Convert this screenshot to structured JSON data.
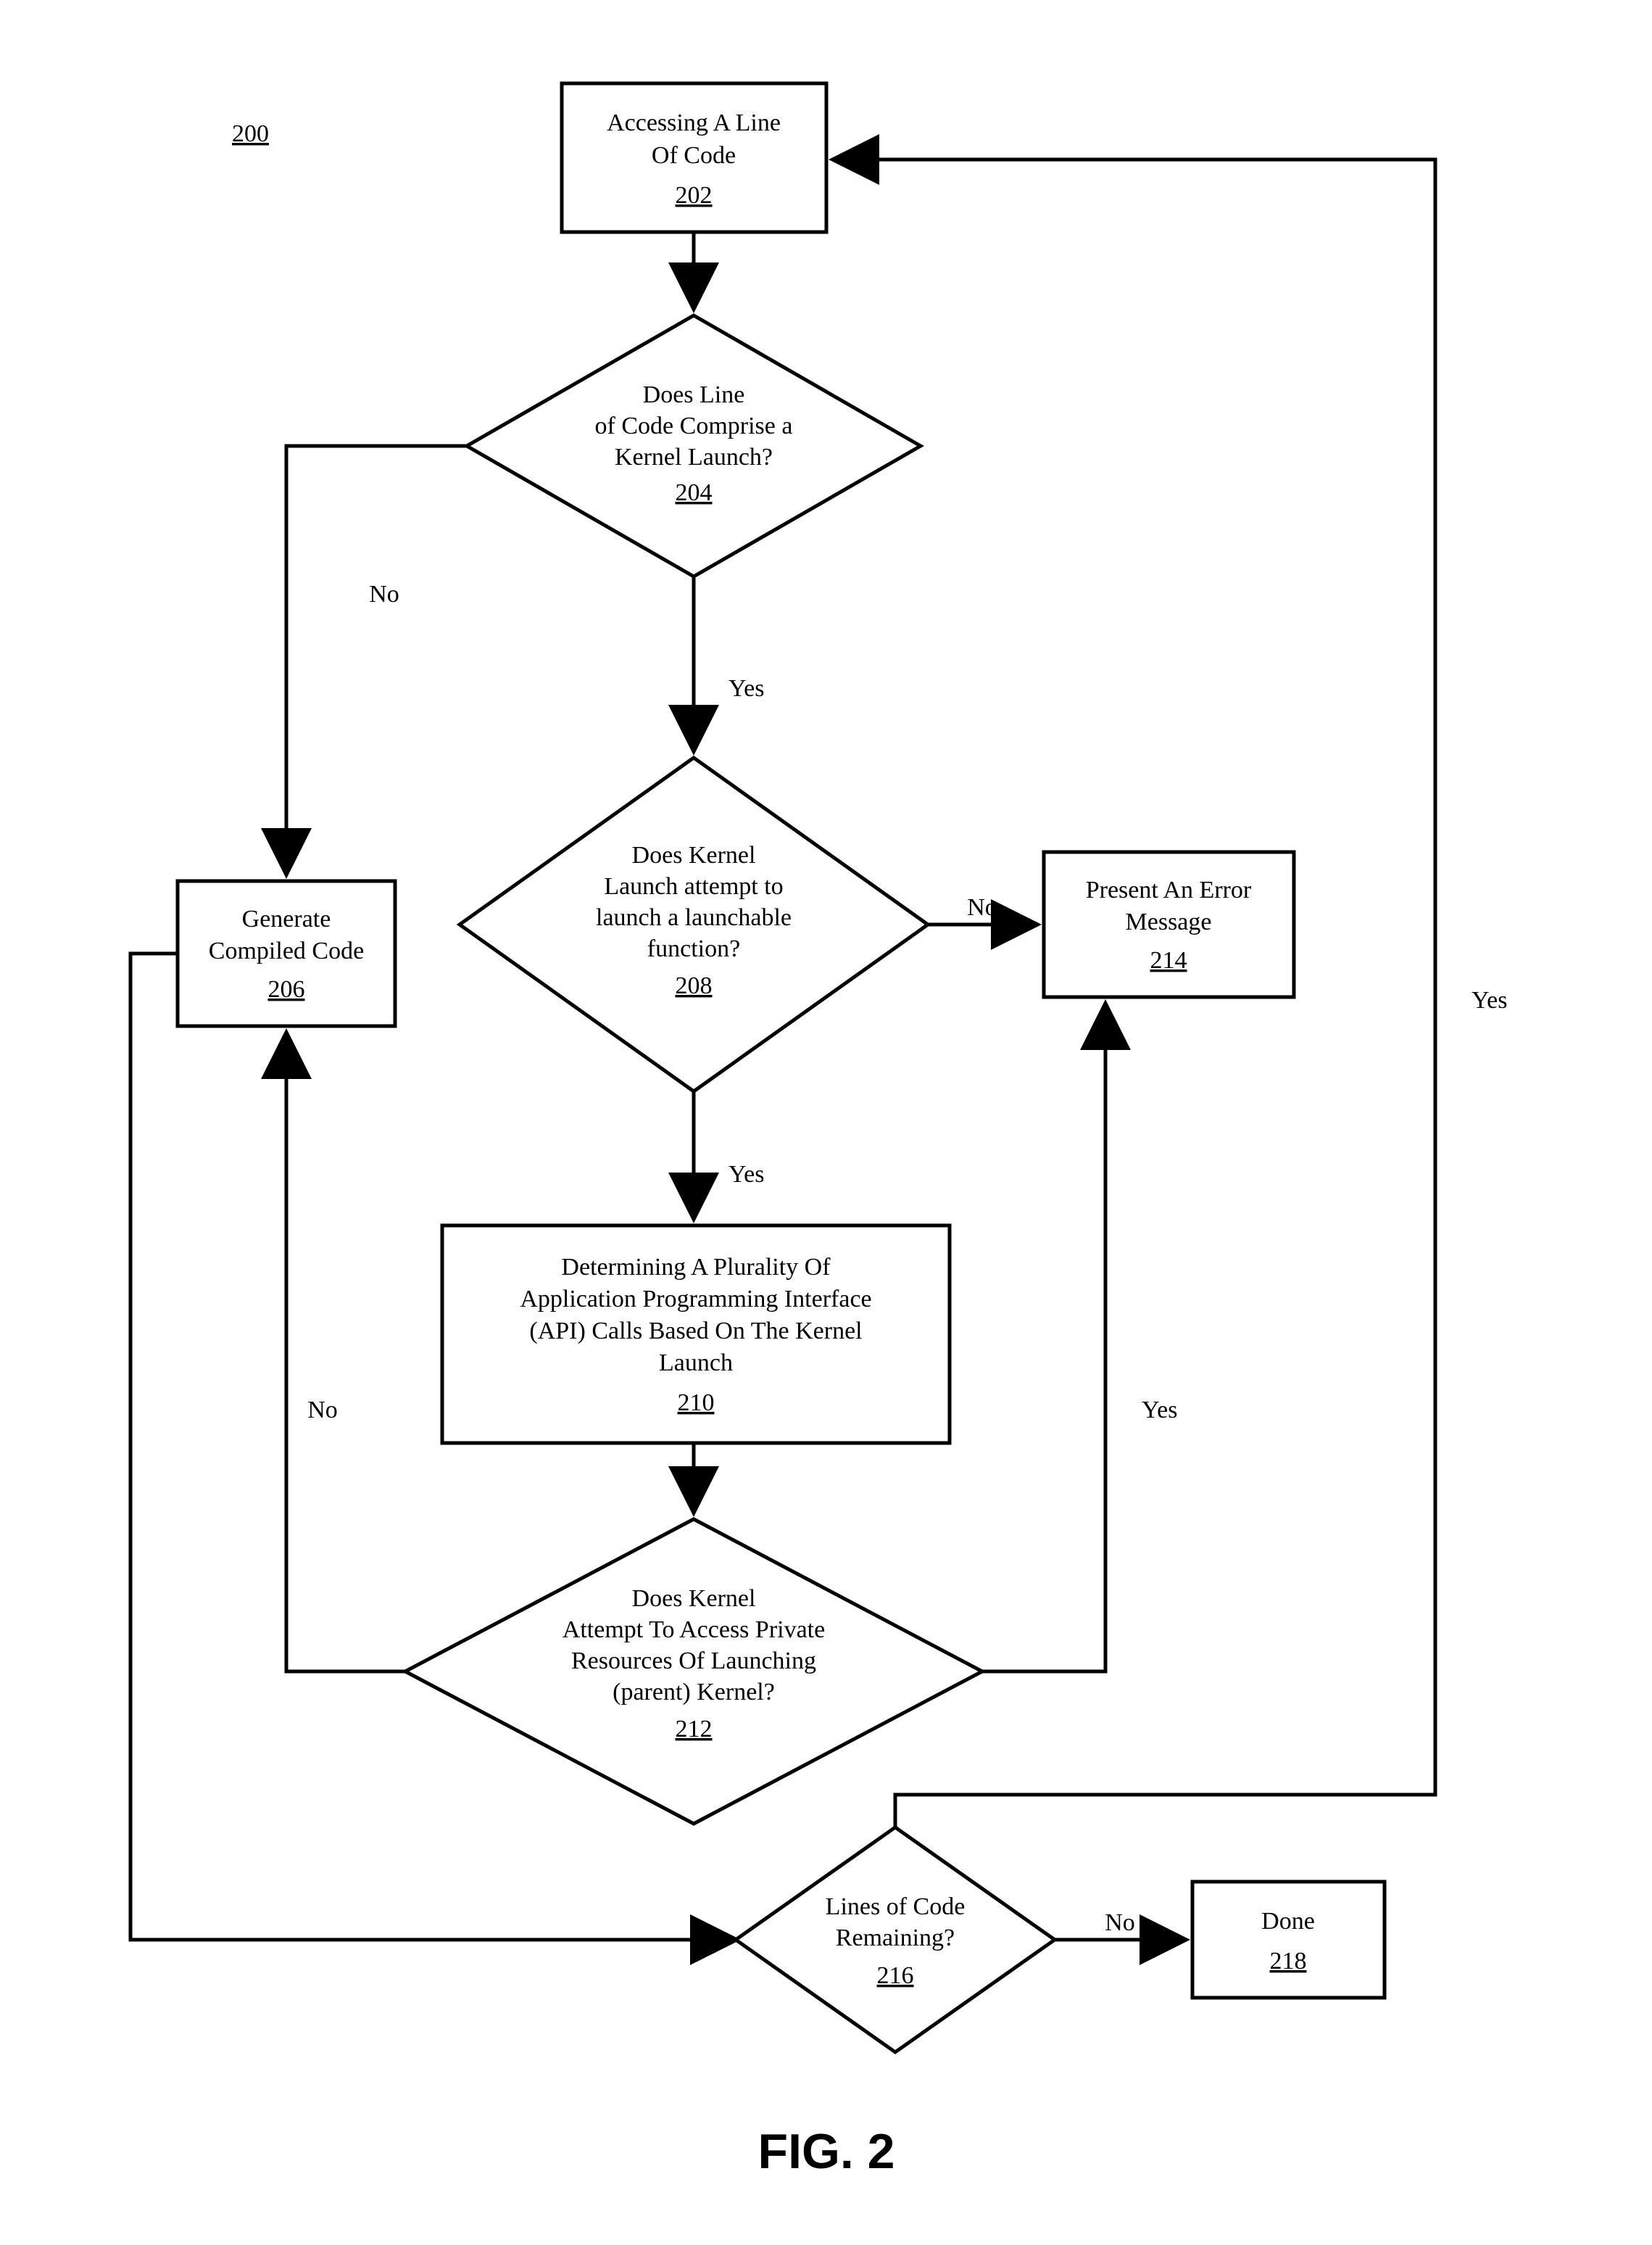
{
  "figure": {
    "ref": "200",
    "title": "FIG. 2"
  },
  "nodes": {
    "n202": {
      "l1": "Accessing A Line",
      "l2": "Of Code",
      "num": "202"
    },
    "n204": {
      "l1": "Does Line",
      "l2": "of Code Comprise a",
      "l3": "Kernel Launch?",
      "num": "204"
    },
    "n206": {
      "l1": "Generate",
      "l2": "Compiled Code",
      "num": "206"
    },
    "n208": {
      "l1": "Does Kernel",
      "l2": "Launch attempt to",
      "l3": "launch a launchable",
      "l4": "function?",
      "num": "208"
    },
    "n210": {
      "l1": "Determining A Plurality Of",
      "l2": "Application Programming Interface",
      "l3": "(API) Calls Based On The Kernel",
      "l4": "Launch",
      "num": "210"
    },
    "n212": {
      "l1": "Does Kernel",
      "l2": "Attempt To Access Private",
      "l3": "Resources Of Launching",
      "l4": "(parent) Kernel?",
      "num": "212"
    },
    "n214": {
      "l1": "Present An Error",
      "l2": "Message",
      "num": "214"
    },
    "n216": {
      "l1": "Lines of Code",
      "l2": "Remaining?",
      "num": "216"
    },
    "n218": {
      "l1": "Done",
      "num": "218"
    }
  },
  "labels": {
    "yes": "Yes",
    "no": "No"
  }
}
